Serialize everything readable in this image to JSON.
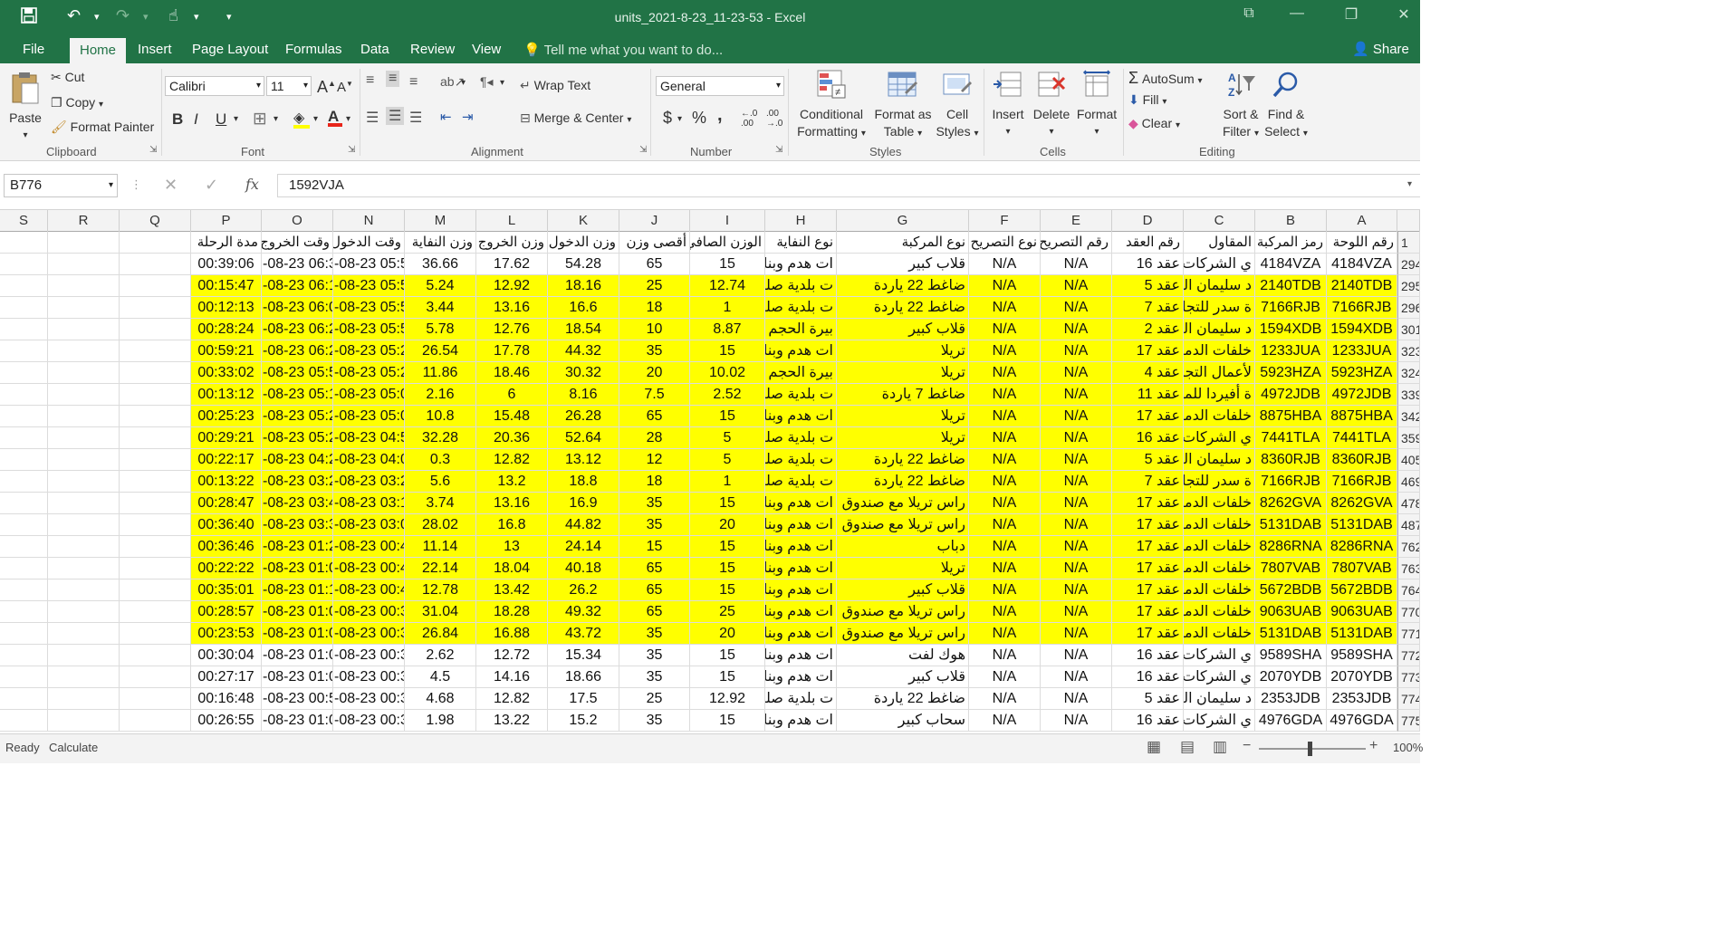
{
  "title_bar": {
    "title": "units_2021-8-23_11-23-53 - Excel"
  },
  "tabs": [
    "File",
    "Home",
    "Insert",
    "Page Layout",
    "Formulas",
    "Data",
    "Review",
    "View"
  ],
  "tell_me": "Tell me what you want to do...",
  "share": "Share",
  "ribbon": {
    "clipboard": {
      "paste": "Paste",
      "cut": "Cut",
      "copy": "Copy",
      "format_painter": "Format Painter",
      "label": "Clipboard"
    },
    "font": {
      "name": "Calibri",
      "size": "11",
      "bold": "B",
      "italic": "I",
      "underline": "U",
      "label": "Font"
    },
    "alignment": {
      "wrap_text": "Wrap Text",
      "merge_center": "Merge & Center",
      "label": "Alignment"
    },
    "number": {
      "format": "General",
      "currency": "$",
      "percent": "%",
      "comma": ",",
      "label": "Number"
    },
    "styles": {
      "conditional": "Conditional",
      "conditional2": "Formatting",
      "format_as": "Format as",
      "format_as2": "Table",
      "cell": "Cell",
      "cell2": "Styles",
      "label": "Styles"
    },
    "cells": {
      "insert": "Insert",
      "delete": "Delete",
      "format": "Format",
      "label": "Cells"
    },
    "editing": {
      "autosum": "AutoSum",
      "fill": "Fill",
      "clear": "Clear",
      "sort": "Sort &",
      "sort2": "Filter",
      "find": "Find &",
      "find2": "Select",
      "label": "Editing"
    }
  },
  "formula_bar": {
    "name_box": "B776",
    "fx": "fx",
    "value": "1592VJA"
  },
  "columns": [
    "S",
    "R",
    "Q",
    "P",
    "O",
    "N",
    "M",
    "L",
    "K",
    "J",
    "I",
    "H",
    "G",
    "F",
    "E",
    "D",
    "C",
    "B",
    "A"
  ],
  "header_row": {
    "row_num": "1",
    "A": "رقم اللوحة",
    "B": "رمز المركبة",
    "C": "المقاول",
    "D": "رقم العقد",
    "E": "رقم التصريح",
    "F": "نوع التصريح",
    "G": "نوع المركبة",
    "H": "نوع النفاية",
    "I": "الوزن الصافي",
    "J": "أقصى وزن",
    "K": "وزن الدخول",
    "L": "وزن الخروج",
    "M": "وزن النفاية",
    "N": "وقت الدخول",
    "O": "وقت الخروج",
    "P": "مدة الرحلة"
  },
  "rows": [
    {
      "n": "294",
      "yellow": false,
      "A": "4184VZA",
      "B": "4184VZA",
      "C": "ي الشركات التي",
      "D": "عقد 16",
      "E": "N/A",
      "F": "N/A",
      "G": "قلاب كبير",
      "H": "ات هدم وبناء",
      "I": "15",
      "J": "65",
      "K": "54.28",
      "L": "17.62",
      "M": "36.66",
      "N": "-08-23 05:5",
      "O": "-08-23 06:3",
      "P": "00:39:06"
    },
    {
      "n": "295",
      "yellow": true,
      "A": "2140TDB",
      "B": "2140TDB",
      "C": "د سليمان الفو",
      "D": "عقد 5",
      "E": "N/A",
      "F": "N/A",
      "G": "ضاغط 22 ياردة",
      "H": "ت بلدية صلبة",
      "I": "12.74",
      "J": "25",
      "K": "18.16",
      "L": "12.92",
      "M": "5.24",
      "N": "-08-23 05:5",
      "O": "-08-23 06:1",
      "P": "00:15:47"
    },
    {
      "n": "296",
      "yellow": true,
      "A": "7166RJB",
      "B": "7166RJB",
      "C": "ة سدر للتجار",
      "D": "عقد 7",
      "E": "N/A",
      "F": "N/A",
      "G": "ضاغط 22 ياردة",
      "H": "ت بلدية صلبة",
      "I": "1",
      "J": "18",
      "K": "16.6",
      "L": "13.16",
      "M": "3.44",
      "N": "-08-23 05:5",
      "O": "-08-23 06:0",
      "P": "00:12:13"
    },
    {
      "n": "301",
      "yellow": true,
      "A": "1594XDB",
      "B": "1594XDB",
      "C": "د سليمان الفو",
      "D": "عقد 2",
      "E": "N/A",
      "F": "N/A",
      "G": "قلاب كبير",
      "H": "بيرة الحجم (",
      "I": "8.87",
      "J": "10",
      "K": "18.54",
      "L": "12.76",
      "M": "5.78",
      "N": "-08-23 05:5",
      "O": "-08-23 06:2",
      "P": "00:28:24"
    },
    {
      "n": "323",
      "yellow": true,
      "A": "1233JUA",
      "B": "1233JUA",
      "C": "خلفات الدمارا",
      "D": "عقد 17",
      "E": "N/A",
      "F": "N/A",
      "G": "تريلا",
      "H": "ات هدم وبناء",
      "I": "15",
      "J": "35",
      "K": "44.32",
      "L": "17.78",
      "M": "26.54",
      "N": "-08-23 05:2",
      "O": "-08-23 06:2",
      "P": "00:59:21"
    },
    {
      "n": "324",
      "yellow": true,
      "A": "5923HZA",
      "B": "5923HZA",
      "C": "لأعمال التجار",
      "D": "عقد 4",
      "E": "N/A",
      "F": "N/A",
      "G": "تريلا",
      "H": "بيرة الحجم (",
      "I": "10.02",
      "J": "20",
      "K": "30.32",
      "L": "18.46",
      "M": "11.86",
      "N": "-08-23 05:2",
      "O": "-08-23 05:5",
      "P": "00:33:02"
    },
    {
      "n": "339",
      "yellow": true,
      "A": "4972JDB",
      "B": "4972JDB",
      "C": "ة أفيردا للمقاو",
      "D": "عقد 11",
      "E": "N/A",
      "F": "N/A",
      "G": "ضاغط 7 ياردة",
      "H": "ت بلدية صلبة",
      "I": "2.52",
      "J": "7.5",
      "K": "8.16",
      "L": "6",
      "M": "2.16",
      "N": "-08-23 05:0",
      "O": "-08-23 05:1",
      "P": "00:13:12"
    },
    {
      "n": "342",
      "yellow": true,
      "A": "8875HBA",
      "B": "8875HBA",
      "C": "خلفات الدمارا",
      "D": "عقد 17",
      "E": "N/A",
      "F": "N/A",
      "G": "تريلا",
      "H": "ات هدم وبناء",
      "I": "15",
      "J": "65",
      "K": "26.28",
      "L": "15.48",
      "M": "10.8",
      "N": "-08-23 05:0",
      "O": "-08-23 05:2",
      "P": "00:25:23"
    },
    {
      "n": "359",
      "yellow": true,
      "A": "7441TLA",
      "B": "7441TLA",
      "C": "ي الشركات التي",
      "D": "عقد 16",
      "E": "N/A",
      "F": "N/A",
      "G": "تريلا",
      "H": "ت بلدية صلبة",
      "I": "5",
      "J": "28",
      "K": "52.64",
      "L": "20.36",
      "M": "32.28",
      "N": "-08-23 04:5",
      "O": "-08-23 05:2",
      "P": "00:29:21"
    },
    {
      "n": "405",
      "yellow": true,
      "A": "8360RJB",
      "B": "8360RJB",
      "C": "د سليمان الفو",
      "D": "عقد 5",
      "E": "N/A",
      "F": "N/A",
      "G": "ضاغط 22 ياردة",
      "H": "ت بلدية صلبة",
      "I": "5",
      "J": "12",
      "K": "13.12",
      "L": "12.82",
      "M": "0.3",
      "N": "-08-23 04:0",
      "O": "-08-23 04:2",
      "P": "00:22:17"
    },
    {
      "n": "469",
      "yellow": true,
      "A": "7166RJB",
      "B": "7166RJB",
      "C": "ة سدر للتجار",
      "D": "عقد 7",
      "E": "N/A",
      "F": "N/A",
      "G": "ضاغط 22 ياردة",
      "H": "ت بلدية صلبة",
      "I": "1",
      "J": "18",
      "K": "18.8",
      "L": "13.2",
      "M": "5.6",
      "N": "-08-23 03:2",
      "O": "-08-23 03:2",
      "P": "00:13:22"
    },
    {
      "n": "478",
      "yellow": true,
      "A": "8262GVA",
      "B": "8262GVA",
      "C": "خلفات الدمارا",
      "D": "عقد 17",
      "E": "N/A",
      "F": "N/A",
      "G": "راس تريلا مع صندوق",
      "H": "ات هدم وبناء",
      "I": "15",
      "J": "35",
      "K": "16.9",
      "L": "13.16",
      "M": "3.74",
      "N": "-08-23 03:1",
      "O": "-08-23 03:4",
      "P": "00:28:47"
    },
    {
      "n": "487",
      "yellow": true,
      "A": "5131DAB",
      "B": "5131DAB",
      "C": "خلفات الدمارا",
      "D": "عقد 17",
      "E": "N/A",
      "F": "N/A",
      "G": "راس تريلا مع صندوق",
      "H": "ات هدم وبناء",
      "I": "20",
      "J": "35",
      "K": "44.82",
      "L": "16.8",
      "M": "28.02",
      "N": "-08-23 03:0",
      "O": "-08-23 03:3",
      "P": "00:36:40"
    },
    {
      "n": "762",
      "yellow": true,
      "A": "8286RNA",
      "B": "8286RNA",
      "C": "خلفات الدمارا",
      "D": "عقد 17",
      "E": "N/A",
      "F": "N/A",
      "G": "دباب",
      "H": "ات هدم وبناء",
      "I": "15",
      "J": "15",
      "K": "24.14",
      "L": "13",
      "M": "11.14",
      "N": "-08-23 00:4",
      "O": "-08-23 01:2",
      "P": "00:36:46"
    },
    {
      "n": "763",
      "yellow": true,
      "A": "7807VAB",
      "B": "7807VAB",
      "C": "خلفات الدمارا",
      "D": "عقد 17",
      "E": "N/A",
      "F": "N/A",
      "G": "تريلا",
      "H": "ات هدم وبناء",
      "I": "15",
      "J": "65",
      "K": "40.18",
      "L": "18.04",
      "M": "22.14",
      "N": "-08-23 00:4",
      "O": "-08-23 01:0",
      "P": "00:22:22"
    },
    {
      "n": "764",
      "yellow": true,
      "A": "5672BDB",
      "B": "5672BDB",
      "C": "خلفات الدمارا",
      "D": "عقد 17",
      "E": "N/A",
      "F": "N/A",
      "G": "قلاب كبير",
      "H": "ات هدم وبناء",
      "I": "15",
      "J": "65",
      "K": "26.2",
      "L": "13.42",
      "M": "12.78",
      "N": "-08-23 00:4",
      "O": "-08-23 01:1",
      "P": "00:35:01"
    },
    {
      "n": "770",
      "yellow": true,
      "A": "9063UAB",
      "B": "9063UAB",
      "C": "خلفات الدمارا",
      "D": "عقد 17",
      "E": "N/A",
      "F": "N/A",
      "G": "راس تريلا مع صندوق",
      "H": "ات هدم وبناء",
      "I": "25",
      "J": "65",
      "K": "49.32",
      "L": "18.28",
      "M": "31.04",
      "N": "-08-23 00:3",
      "O": "-08-23 01:0",
      "P": "00:28:57"
    },
    {
      "n": "771",
      "yellow": true,
      "A": "5131DAB",
      "B": "5131DAB",
      "C": "خلفات الدمارا",
      "D": "عقد 17",
      "E": "N/A",
      "F": "N/A",
      "G": "راس تريلا مع صندوق",
      "H": "ات هدم وبناء",
      "I": "20",
      "J": "35",
      "K": "43.72",
      "L": "16.88",
      "M": "26.84",
      "N": "-08-23 00:3",
      "O": "-08-23 01:0",
      "P": "00:23:53"
    },
    {
      "n": "772",
      "yellow": false,
      "A": "9589SHA",
      "B": "9589SHA",
      "C": "ي الشركات التي",
      "D": "عقد 16",
      "E": "N/A",
      "F": "N/A",
      "G": "هوك لفت",
      "H": "ات هدم وبناء",
      "I": "15",
      "J": "35",
      "K": "15.34",
      "L": "12.72",
      "M": "2.62",
      "N": "-08-23 00:3",
      "O": "-08-23 01:0",
      "P": "00:30:04"
    },
    {
      "n": "773",
      "yellow": false,
      "A": "2070YDB",
      "B": "2070YDB",
      "C": "ي الشركات التي",
      "D": "عقد 16",
      "E": "N/A",
      "F": "N/A",
      "G": "قلاب كبير",
      "H": "ات هدم وبناء",
      "I": "15",
      "J": "35",
      "K": "18.66",
      "L": "14.16",
      "M": "4.5",
      "N": "-08-23 00:3",
      "O": "-08-23 01:0",
      "P": "00:27:17"
    },
    {
      "n": "774",
      "yellow": false,
      "A": "2353JDB",
      "B": "2353JDB",
      "C": "د سليمان الفو",
      "D": "عقد 5",
      "E": "N/A",
      "F": "N/A",
      "G": "ضاغط 22 ياردة",
      "H": "ت بلدية صلبة",
      "I": "12.92",
      "J": "25",
      "K": "17.5",
      "L": "12.82",
      "M": "4.68",
      "N": "-08-23 00:3",
      "O": "-08-23 00:5",
      "P": "00:16:48"
    },
    {
      "n": "775",
      "yellow": false,
      "A": "4976GDA",
      "B": "4976GDA",
      "C": "ي الشركات التي",
      "D": "عقد 16",
      "E": "N/A",
      "F": "N/A",
      "G": "سحاب كبير",
      "H": "ات هدم وبناء",
      "I": "15",
      "J": "35",
      "K": "15.2",
      "L": "13.22",
      "M": "1.98",
      "N": "-08-23 00:3",
      "O": "-08-23 01:0",
      "P": "00:26:55"
    }
  ],
  "status_bar": {
    "ready": "Ready",
    "calculate": "Calculate",
    "zoom": "100%"
  },
  "colors": {
    "excel_green": "#217346",
    "highlight_yellow": "#ffff00",
    "ribbon_bg": "#f3f3f3"
  }
}
